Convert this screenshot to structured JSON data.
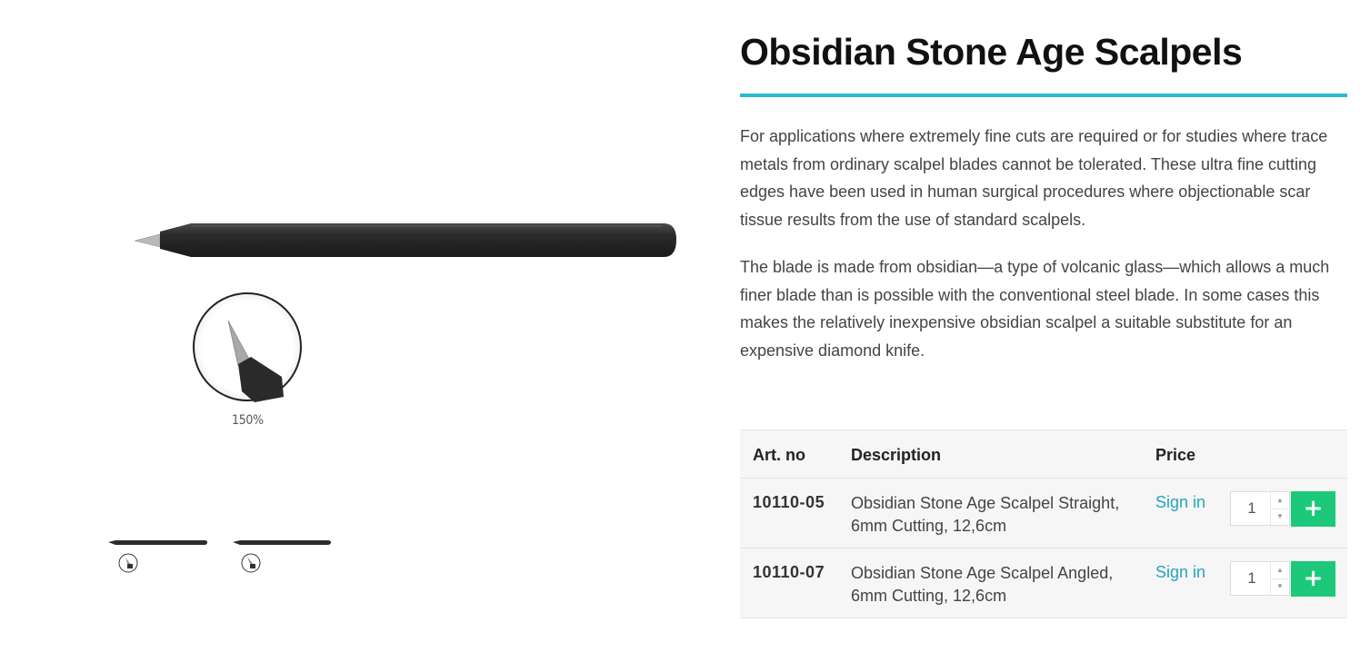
{
  "product": {
    "title": "Obsidian Stone Age Scalpels",
    "description": [
      "For applications where extremely fine cuts are required or for studies where trace metals from ordinary scalpel blades cannot be tolerated. These ultra fine cutting edges have been used in human surgical procedures where objectionable scar tissue results from the use of standard scalpels.",
      "The blade is made from obsidian—a type of volcanic glass—which allows a much finer blade than is possible with the conventional steel blade. In some cases this makes the relatively inexpensive obsidian scalpel a suitable substitute for an expensive diamond knife."
    ]
  },
  "gallery": {
    "main_alt": "Obsidian scalpel with 150% zoom detail of blade tip",
    "zoom_label": "150%",
    "thumbnails": [
      "scalpel-thumbnail-1",
      "scalpel-thumbnail-2"
    ]
  },
  "table": {
    "headers": {
      "art_no": "Art. no",
      "description": "Description",
      "price": "Price"
    },
    "rows": [
      {
        "art_no": "10110-05",
        "description": "Obsidian Stone Age Scalpel Straight, 6mm Cutting, 12,6cm",
        "price": "Sign in",
        "quantity": "1",
        "add": "+"
      },
      {
        "art_no": "10110-07",
        "description": "Obsidian Stone Age Scalpel Angled, 6mm Cutting, 12,6cm",
        "price": "Sign in",
        "quantity": "1",
        "add": "+"
      }
    ]
  },
  "icons": {
    "spin_up": "▲",
    "spin_down": "▼"
  },
  "colors": {
    "accent_rule": "#2bb9cf",
    "link": "#25a5bd",
    "add_button": "#1cc97a",
    "table_bg": "#f6f6f6"
  }
}
